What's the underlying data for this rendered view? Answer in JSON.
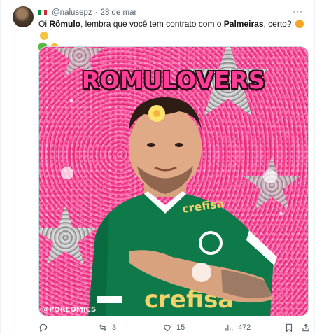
{
  "tweet": {
    "handle": "@nalusepz",
    "separator": "·",
    "date": "28 de mar",
    "flag": "italy-flag",
    "more": "···",
    "text": {
      "p1": "Oi ",
      "b1": "Rômulo",
      "p2": ", lembra que você tem contrato com o ",
      "b2": "Palmeiras",
      "p3": ", certo?"
    },
    "emojis": [
      "smiling-face-with-hearts",
      "shushing-hand",
      "green-heart",
      "star-struck"
    ]
  },
  "media": {
    "headline": "ROMULOVERS",
    "watermark": "@POREOMICS",
    "shirt_text": "crefisa",
    "colors": {
      "pink": "#ee3e8c",
      "shirt": "#0e7a4a",
      "headline": "#ff3d97"
    }
  },
  "actions": {
    "reply_count": "",
    "retweet_count": "3",
    "like_count": "15",
    "views_count": "472"
  }
}
